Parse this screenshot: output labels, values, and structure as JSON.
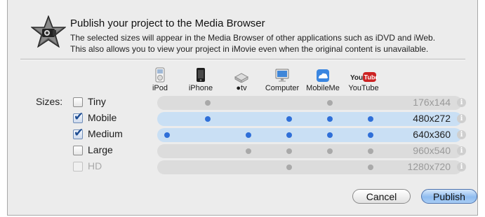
{
  "dialog": {
    "title": "Publish your project to the Media Browser",
    "description_line1": "The selected sizes will appear in the Media Browser of other applications such as iDVD and iWeb.",
    "description_line2": "This also allows you to view your project in iMovie even when the original content is unavailable."
  },
  "devices": [
    {
      "label": "iPod",
      "icon": "ipod-icon"
    },
    {
      "label": "iPhone",
      "icon": "iphone-icon"
    },
    {
      "label": "tv",
      "icon": "apple-tv-icon"
    },
    {
      "label": "Computer",
      "icon": "computer-icon"
    },
    {
      "label": "MobileMe",
      "icon": "mobileme-icon"
    },
    {
      "label": "YouTube",
      "icon": "youtube-icon"
    }
  ],
  "sizes_label": "Sizes:",
  "rows": [
    {
      "label": "Tiny",
      "checked": false,
      "enabled": true,
      "resolution": "176x144",
      "dots": [
        false,
        true,
        false,
        false,
        true,
        false
      ],
      "selected": false
    },
    {
      "label": "Mobile",
      "checked": true,
      "enabled": true,
      "resolution": "480x272",
      "dots": [
        false,
        true,
        false,
        true,
        true,
        true
      ],
      "selected": true
    },
    {
      "label": "Medium",
      "checked": true,
      "enabled": true,
      "resolution": "640x360",
      "dots": [
        true,
        false,
        true,
        true,
        true,
        true
      ],
      "selected": true
    },
    {
      "label": "Large",
      "checked": false,
      "enabled": true,
      "resolution": "960x540",
      "dots": [
        false,
        false,
        true,
        true,
        true,
        true
      ],
      "selected": false
    },
    {
      "label": "HD",
      "checked": false,
      "enabled": false,
      "resolution": "1280x720",
      "dots": [
        false,
        false,
        false,
        true,
        false,
        true
      ],
      "selected": false
    }
  ],
  "buttons": {
    "cancel": "Cancel",
    "publish": "Publish"
  },
  "colors": {
    "selected_dot": "#2f6fd8",
    "unselected_dot": "#a9a9a9",
    "selected_track": "#c9dff4",
    "unselected_track": "#dcdcdc"
  }
}
